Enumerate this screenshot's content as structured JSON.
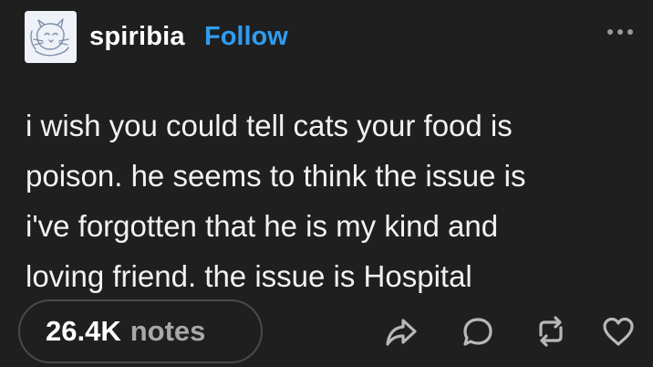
{
  "header": {
    "username": "spiribia",
    "follow_label": "Follow",
    "avatar_icon": "cat-sketch-avatar",
    "more_icon": "more-options-icon"
  },
  "post": {
    "lines": [
      "i wish you could  tell cats your food is",
      "poison. he seems to think the issue is",
      "i've forgotten that he is my kind and",
      "loving friend. the issue is Hospital"
    ]
  },
  "footer": {
    "notes_count": "26.4K",
    "notes_label": "notes",
    "actions": [
      "share-icon",
      "reply-icon",
      "reblog-icon",
      "like-icon"
    ]
  },
  "colors": {
    "background": "#1f1f1f",
    "accent": "#2f9cf0",
    "text": "#f2f2f2",
    "muted": "#a8a8a8"
  }
}
